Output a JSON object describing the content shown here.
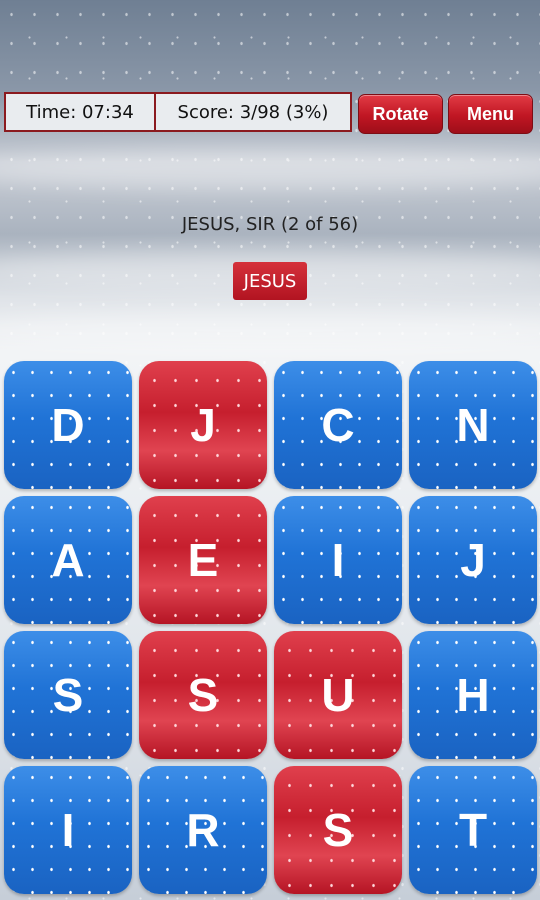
{
  "header": {
    "time_text": "Time: 07:34",
    "score_text": "Score: 3/98 (3%)",
    "rotate_label": "Rotate",
    "menu_label": "Menu"
  },
  "clue": {
    "text": "JESUS, SIR (2 of 56)"
  },
  "current_word": "JESUS",
  "colors": {
    "tile_blue": "#2073d6",
    "tile_red": "#c61f2e",
    "frame": "#8b1a1f"
  },
  "grid": {
    "rows": [
      [
        {
          "letter": "D",
          "state": "blue"
        },
        {
          "letter": "J",
          "state": "red"
        },
        {
          "letter": "C",
          "state": "blue"
        },
        {
          "letter": "N",
          "state": "blue"
        }
      ],
      [
        {
          "letter": "A",
          "state": "blue"
        },
        {
          "letter": "E",
          "state": "red"
        },
        {
          "letter": "I",
          "state": "blue"
        },
        {
          "letter": "J",
          "state": "blue"
        }
      ],
      [
        {
          "letter": "S",
          "state": "blue"
        },
        {
          "letter": "S",
          "state": "red"
        },
        {
          "letter": "U",
          "state": "red"
        },
        {
          "letter": "H",
          "state": "blue"
        }
      ],
      [
        {
          "letter": "I",
          "state": "blue"
        },
        {
          "letter": "R",
          "state": "blue"
        },
        {
          "letter": "S",
          "state": "red"
        },
        {
          "letter": "T",
          "state": "blue"
        }
      ]
    ]
  }
}
